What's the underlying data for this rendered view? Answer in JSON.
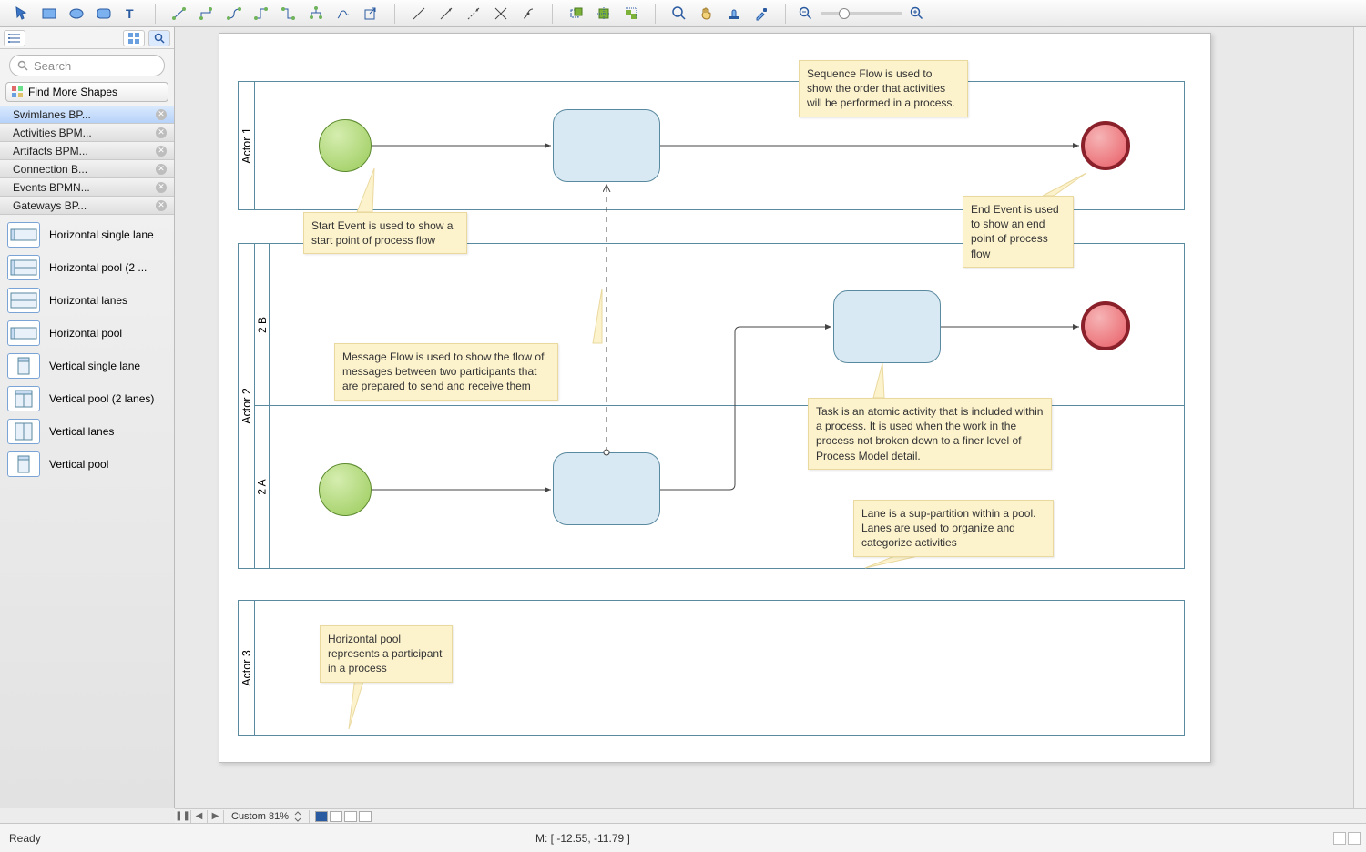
{
  "toolbar": {
    "groups": [
      [
        "pointer-icon",
        "rectangle-icon",
        "ellipse-icon",
        "rounded-rect-icon",
        "text-icon"
      ],
      [
        "connector-straight-icon",
        "connector-elbow-icon",
        "connector-curve-icon",
        "connector-step-icon",
        "connector-rev-icon",
        "connector-tree-icon",
        "connector-free-icon",
        "export-icon"
      ],
      [
        "line1-icon",
        "line2-icon",
        "line3-icon",
        "line4-icon",
        "line5-icon"
      ],
      [
        "snap1-icon",
        "snap2-icon",
        "snap3-icon"
      ],
      [
        "zoom-in-icon",
        "pan-icon",
        "stamp-icon",
        "eyedropper-icon"
      ]
    ]
  },
  "sidebar": {
    "search_placeholder": "Search",
    "find_more": "Find More Shapes",
    "categories": [
      {
        "label": "Swimlanes BP...",
        "selected": true
      },
      {
        "label": "Activities BPM..."
      },
      {
        "label": "Artifacts BPM..."
      },
      {
        "label": "Connection B..."
      },
      {
        "label": "Events BPMN..."
      },
      {
        "label": "Gateways BP..."
      }
    ],
    "shapes": [
      {
        "label": "Horizontal single lane",
        "kind": "hsingle"
      },
      {
        "label": "Horizontal pool (2 ...",
        "kind": "hpool2"
      },
      {
        "label": "Horizontal lanes",
        "kind": "hlanes"
      },
      {
        "label": "Horizontal pool",
        "kind": "hpool"
      },
      {
        "label": "Vertical single lane",
        "kind": "vsingle"
      },
      {
        "label": "Vertical pool (2 lanes)",
        "kind": "vpool2"
      },
      {
        "label": "Vertical lanes",
        "kind": "vlanes"
      },
      {
        "label": "Vertical pool",
        "kind": "vpool"
      }
    ]
  },
  "canvas": {
    "pools": {
      "p1": "Actor 1",
      "p2": "Actor 2",
      "p2a": "2 A",
      "p2b": "2 B",
      "p3": "Actor 3"
    },
    "notes": {
      "seq": "Sequence Flow is used to show the order that activities will be performed in a process.",
      "start": "Start  Event is used to show a start point of process flow",
      "end": "End Event is used to show an end point of process flow",
      "msg": "Message Flow is used to show the flow of messages between two participants that are prepared to send and receive them",
      "task": "Task is an atomic activity that is included within a process. It is used when the work in the process not broken down to a finer level of Process Model detail.",
      "lane": "Lane is a sup-partition within a pool. Lanes are used to organize and categorize activities",
      "hpool": "Horizontal pool represents a participant in a process"
    }
  },
  "footer": {
    "zoom": "Custom 81%",
    "status": "Ready",
    "mouse": "M: [ -12.55, -11.79 ]"
  }
}
